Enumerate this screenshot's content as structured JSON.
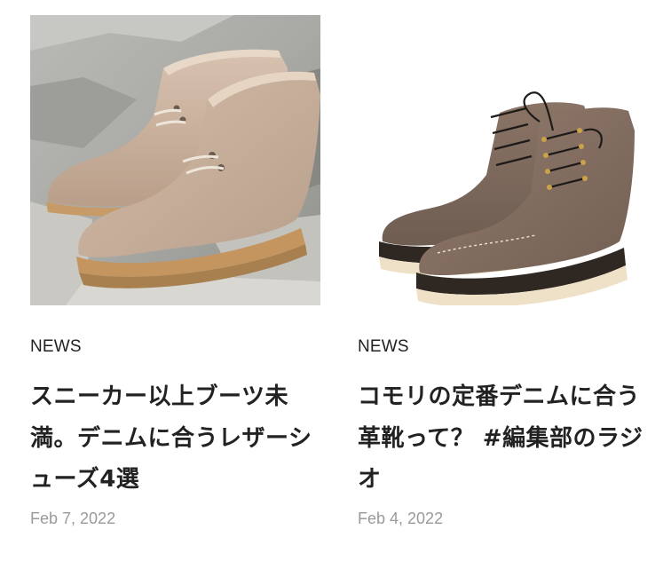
{
  "articles": [
    {
      "image": "desert-boots-photo",
      "category": "NEWS",
      "title": "スニーカー以上ブーツ未満。デニムに合うレザーシューズ4選",
      "date": "Feb 7, 2022"
    },
    {
      "image": "work-boots-photo",
      "category": "NEWS",
      "title": "コモリの定番デニムに合う革靴って？ #編集部のラジオ",
      "date": "Feb 4, 2022"
    }
  ],
  "colors": {
    "text": "#222222",
    "date": "#9a9a9a",
    "background": "#ffffff"
  }
}
